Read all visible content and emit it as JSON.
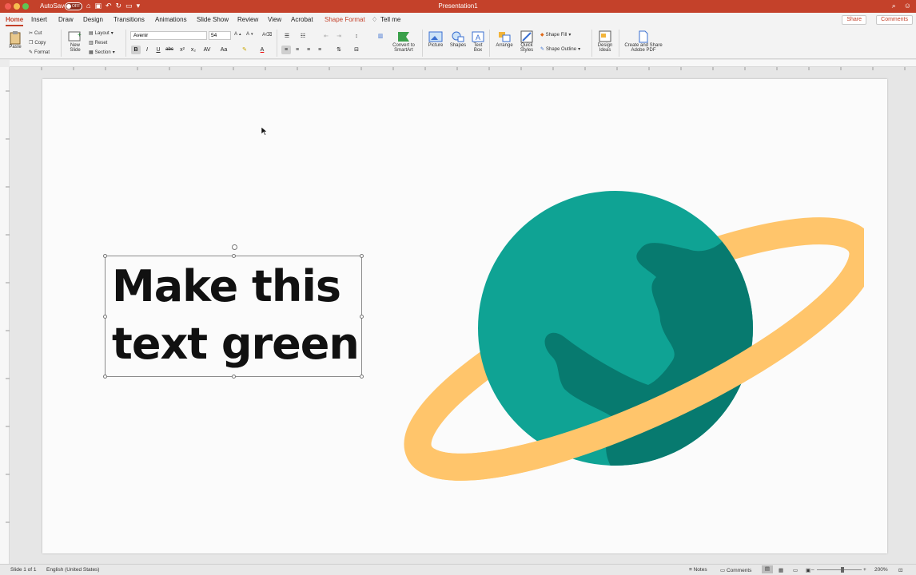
{
  "app": {
    "document_title": "Presentation1",
    "autosave_label": "AutoSave",
    "autosave_state": "OFF"
  },
  "tabs": [
    {
      "label": "Home",
      "active": true
    },
    {
      "label": "Insert"
    },
    {
      "label": "Draw"
    },
    {
      "label": "Design"
    },
    {
      "label": "Transitions"
    },
    {
      "label": "Animations"
    },
    {
      "label": "Slide Show"
    },
    {
      "label": "Review"
    },
    {
      "label": "View"
    },
    {
      "label": "Acrobat"
    },
    {
      "label": "Shape Format"
    },
    {
      "label": "Tell me"
    }
  ],
  "header_buttons": {
    "share": "Share",
    "comments": "Comments"
  },
  "ribbon": {
    "paste": "Paste",
    "cut": "Cut",
    "copy": "Copy",
    "format": "Format",
    "new_slide_line1": "New",
    "new_slide_line2": "Slide",
    "layout": "Layout",
    "reset": "Reset",
    "section": "Section",
    "font_name": "Avenir",
    "font_size": "54",
    "bold": "B",
    "italic": "I",
    "underline": "U",
    "strike": "abc",
    "convert_line1": "Convert to",
    "convert_line2": "SmartArt",
    "picture": "Picture",
    "shapes": "Shapes",
    "text_box_line1": "Text",
    "text_box_line2": "Box",
    "arrange": "Arrange",
    "quick_styles_line1": "Quick",
    "quick_styles_line2": "Styles",
    "shape_fill": "Shape Fill",
    "shape_outline": "Shape Outline",
    "design_ideas_line1": "Design",
    "design_ideas_line2": "Ideas",
    "create_share_line1": "Create and Share",
    "create_share_line2": "Adobe PDF"
  },
  "slide": {
    "text_line1": "Make this",
    "text_line2": "text green",
    "text_color": "#111111"
  },
  "colors": {
    "accent": "#c4412a",
    "planet_light": "#0fa394",
    "planet_dark": "#077a6f",
    "ring": "#ffc56b"
  },
  "status": {
    "slide_info": "Slide 1 of 1",
    "language": "English (United States)",
    "notes": "Notes",
    "comments": "Comments",
    "zoom": "200%"
  }
}
